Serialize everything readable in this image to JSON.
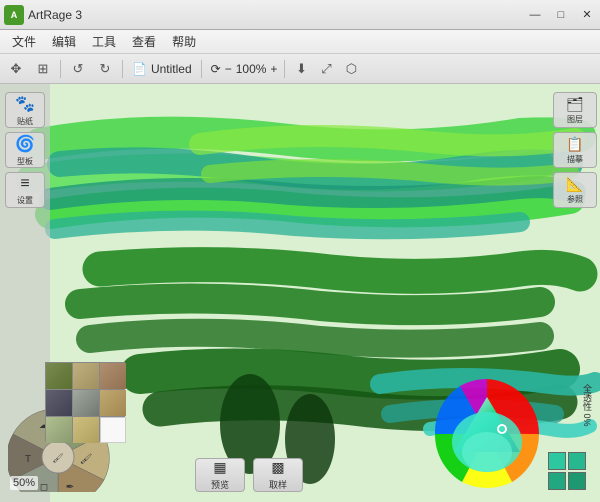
{
  "titlebar": {
    "app_name": "ArtRage 3",
    "doc_title": "Untitled",
    "minimize": "—",
    "maximize": "□",
    "close": "✕"
  },
  "menubar": {
    "items": [
      "文件",
      "编辑",
      "工具",
      "查看",
      "帮助"
    ]
  },
  "toolbar": {
    "move_icon": "✥",
    "grid_icon": "⊞",
    "undo_icon": "↺",
    "redo_icon": "↻",
    "doc_icon": "📄",
    "title": "Untitled",
    "rotate_icon": "⟳",
    "zoom_label": "100%",
    "zoom_minus": "−",
    "zoom_plus": "+",
    "export1_icon": "⬇",
    "export2_icon": "⤢",
    "export3_icon": "⬡"
  },
  "left_panel": {
    "buttons": [
      {
        "icon": "🐾",
        "label": "贴纸"
      },
      {
        "icon": "🌀",
        "label": "型板"
      },
      {
        "icon": "≡",
        "label": "设置"
      }
    ]
  },
  "right_panel": {
    "buttons": [
      {
        "icon": "🗂",
        "label": "图层"
      },
      {
        "icon": "📋",
        "label": "描摹"
      },
      {
        "icon": "📐",
        "label": "参照"
      }
    ]
  },
  "bottom": {
    "size_label": "50%",
    "preview_label": "预览",
    "sample_label": "取样",
    "color_label": "全透性 0%",
    "preview_icon": "▦",
    "sample_icon": "▩"
  },
  "colors": {
    "bg": "#e8f5e0",
    "accent_green": "#3dd63d",
    "dark_green": "#1a6b1a",
    "teal": "#2ab5a0"
  }
}
